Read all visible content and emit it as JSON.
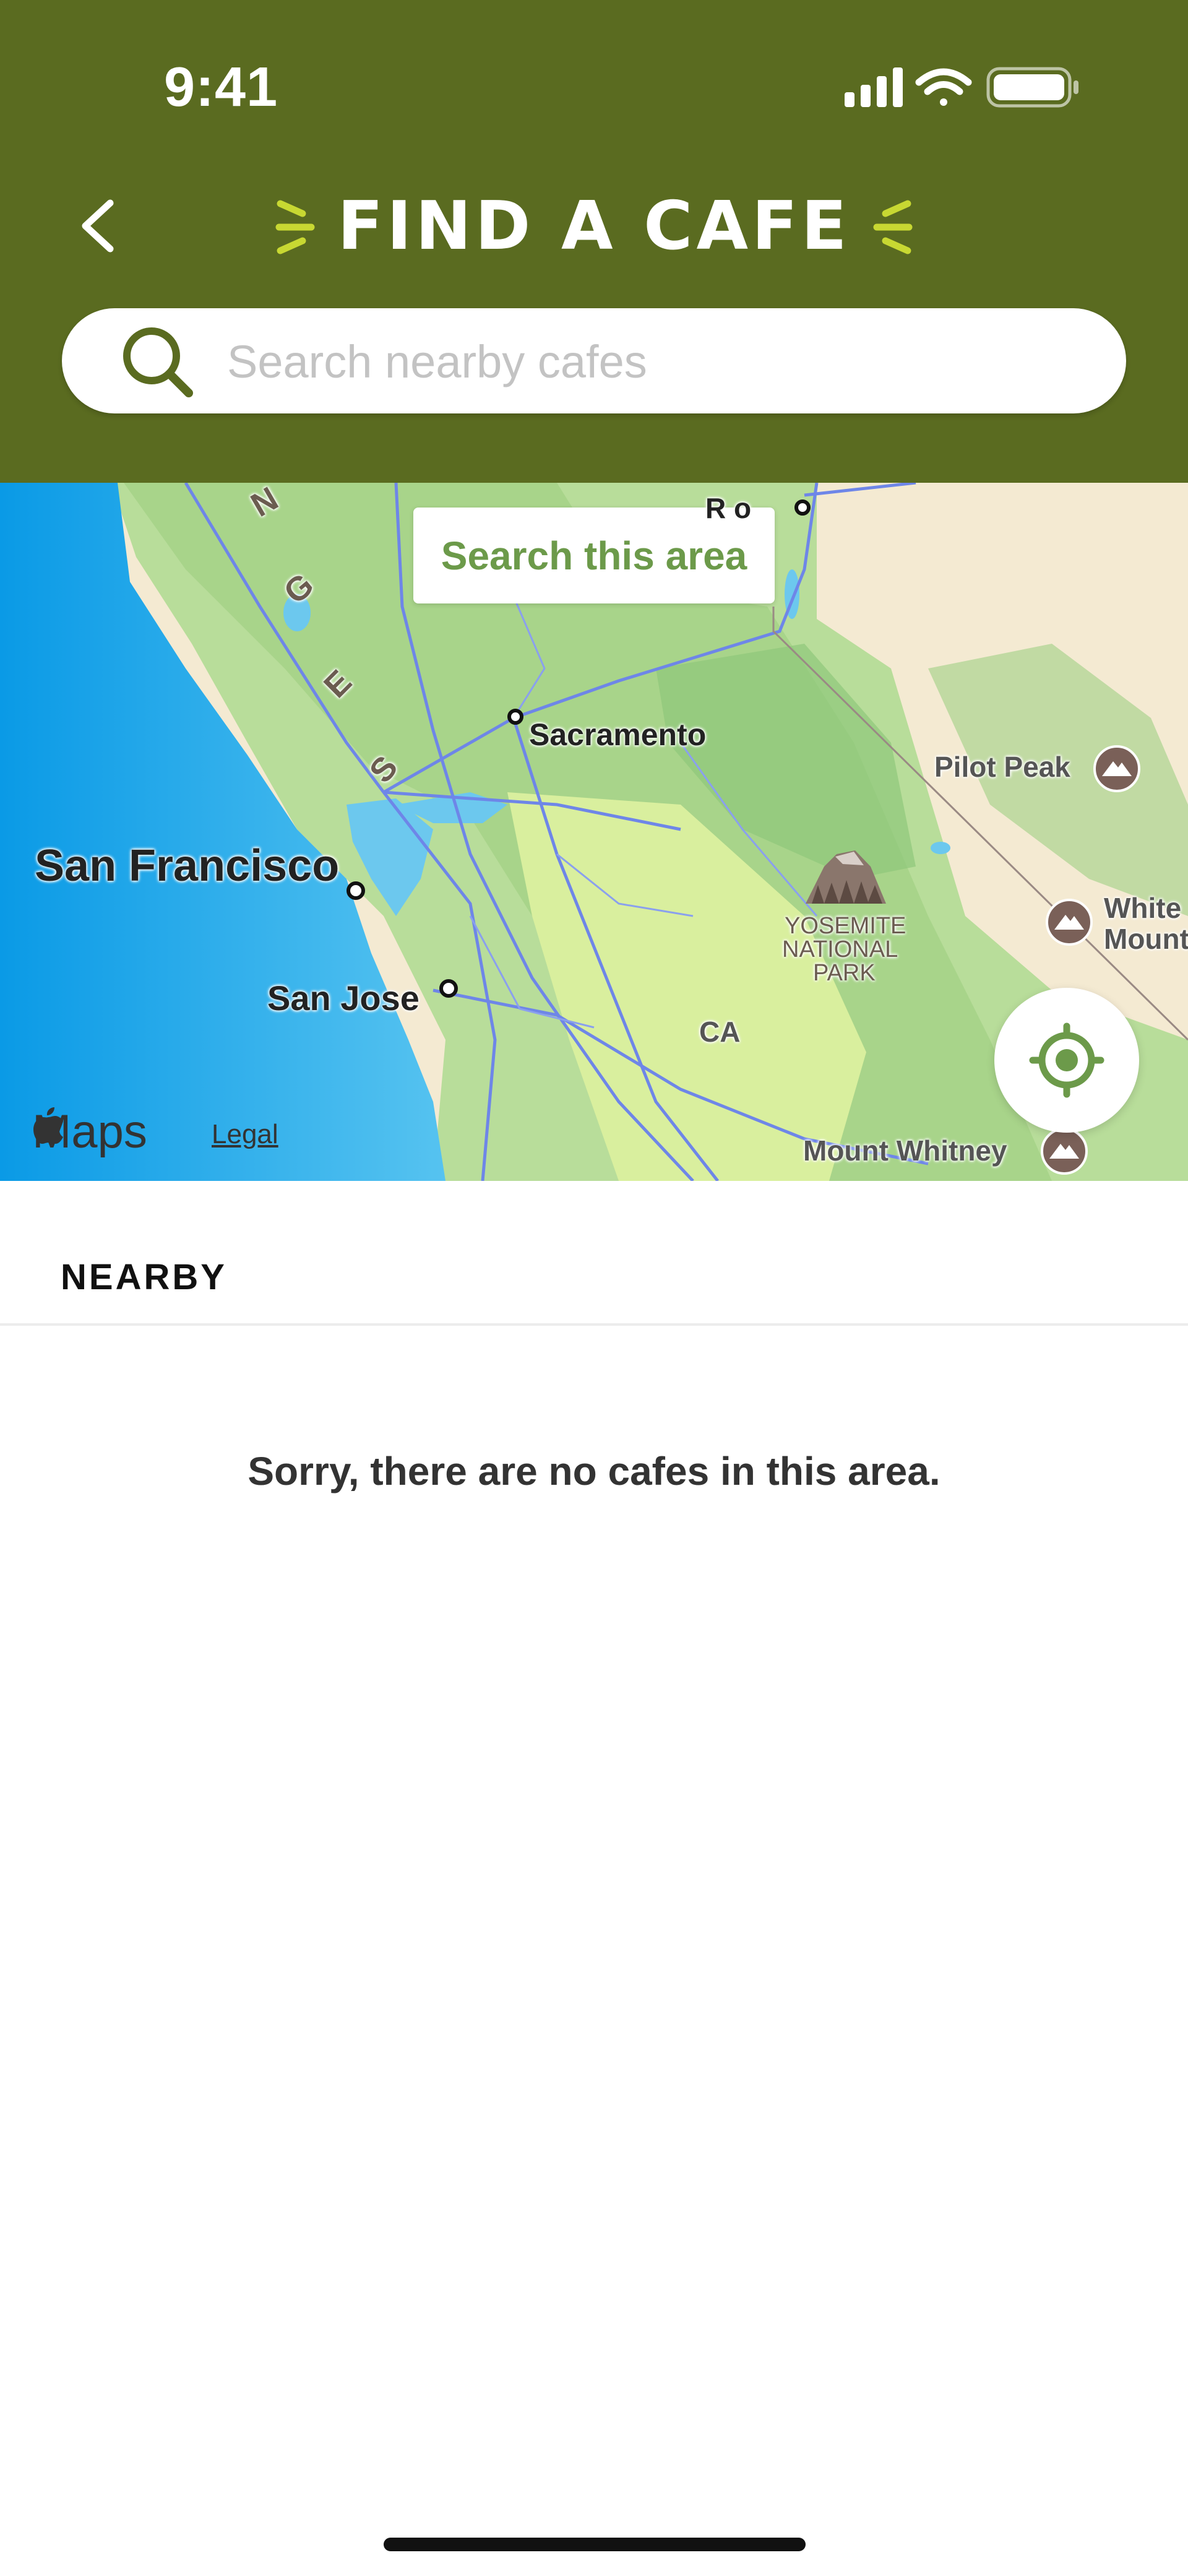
{
  "status_bar": {
    "time": "9:41"
  },
  "header": {
    "title": "FIND A CAFE",
    "background_color": "#5a6b20",
    "accent_color": "#c8d832"
  },
  "search": {
    "placeholder": "Search nearby cafes",
    "value": ""
  },
  "map": {
    "search_area_label": "Search this area",
    "labels": {
      "sacramento": "Sacramento",
      "san_francisco": "San Francisco",
      "san_jose": "San Jose",
      "pilot_peak": "Pilot Peak",
      "white_mountain_1": "White",
      "white_mountain_2": "Mount",
      "yosemite_1": "YOSEMITE",
      "yosemite_2": "NATIONAL",
      "yosemite_3": "PARK",
      "ca": "CA",
      "mount_whitney": "Mount Whitney",
      "range_letters": [
        "N",
        "G",
        "E",
        "S"
      ],
      "reno_partial": "R o"
    },
    "attribution": {
      "maps": "Maps",
      "legal": "Legal"
    }
  },
  "nearby": {
    "heading": "NEARBY",
    "empty_message": "Sorry, there are no cafes in this area."
  },
  "icons": [
    "back-chevron-icon",
    "search-icon",
    "signal-icon",
    "wifi-icon",
    "battery-icon",
    "locate-icon",
    "apple-logo-icon",
    "mountain-peak-icon",
    "national-park-icon"
  ]
}
